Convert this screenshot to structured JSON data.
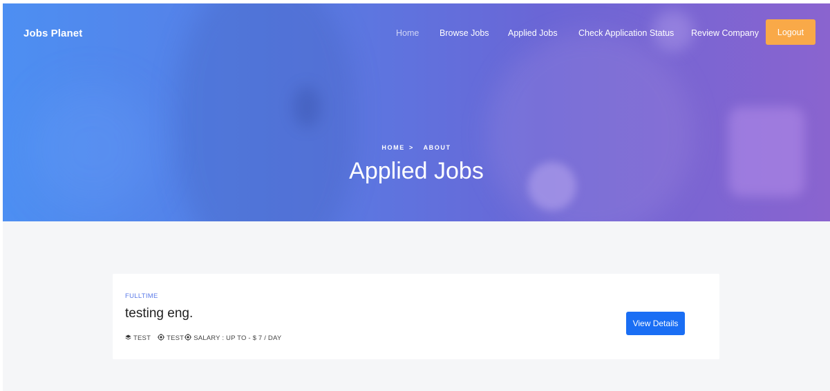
{
  "header": {
    "brand": "Jobs Planet",
    "nav": [
      {
        "label": "Home"
      },
      {
        "label": "Browse Jobs"
      },
      {
        "label": "Applied Jobs"
      },
      {
        "label": "Check Application Status"
      },
      {
        "label": "Review Company"
      }
    ],
    "logout_label": "Logout"
  },
  "hero": {
    "breadcrumb_home": "HOME",
    "breadcrumb_separator": ">",
    "breadcrumb_current": "ABOUT",
    "title": "Applied Jobs"
  },
  "jobs": [
    {
      "type": "FULLTIME",
      "title": "testing eng.",
      "company": "TEST",
      "location": "TEST",
      "salary": "SALARY : UP TO - $ 7 / DAY",
      "button_label": "View Details"
    }
  ],
  "icons": {
    "company": "layers-icon",
    "location": "map-pin-icon",
    "salary": "money-icon"
  },
  "colors": {
    "accent": "#1a6ef4",
    "logout": "#f9a948",
    "job_type": "#5b7be8"
  }
}
